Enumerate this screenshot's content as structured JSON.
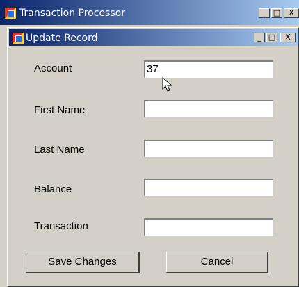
{
  "outer_window": {
    "title": "Transaction Processor",
    "controls": {
      "minimize": "_",
      "maximize": "□",
      "close": "X"
    }
  },
  "dialog": {
    "title": "Update Record",
    "controls": {
      "minimize": "_",
      "maximize": "□",
      "close": "X"
    },
    "fields": [
      {
        "label": "Account",
        "value": "37"
      },
      {
        "label": "First Name",
        "value": ""
      },
      {
        "label": "Last Name",
        "value": ""
      },
      {
        "label": "Balance",
        "value": ""
      },
      {
        "label": "Transaction",
        "value": ""
      }
    ],
    "buttons": {
      "save": "Save Changes",
      "cancel": "Cancel"
    }
  },
  "icons": [
    "app-icon",
    "dialog-icon",
    "mouse-cursor-icon"
  ],
  "colors": {
    "titlebar_start": "#0a246a",
    "titlebar_end": "#a6caf0",
    "face": "#d4d0c8"
  }
}
